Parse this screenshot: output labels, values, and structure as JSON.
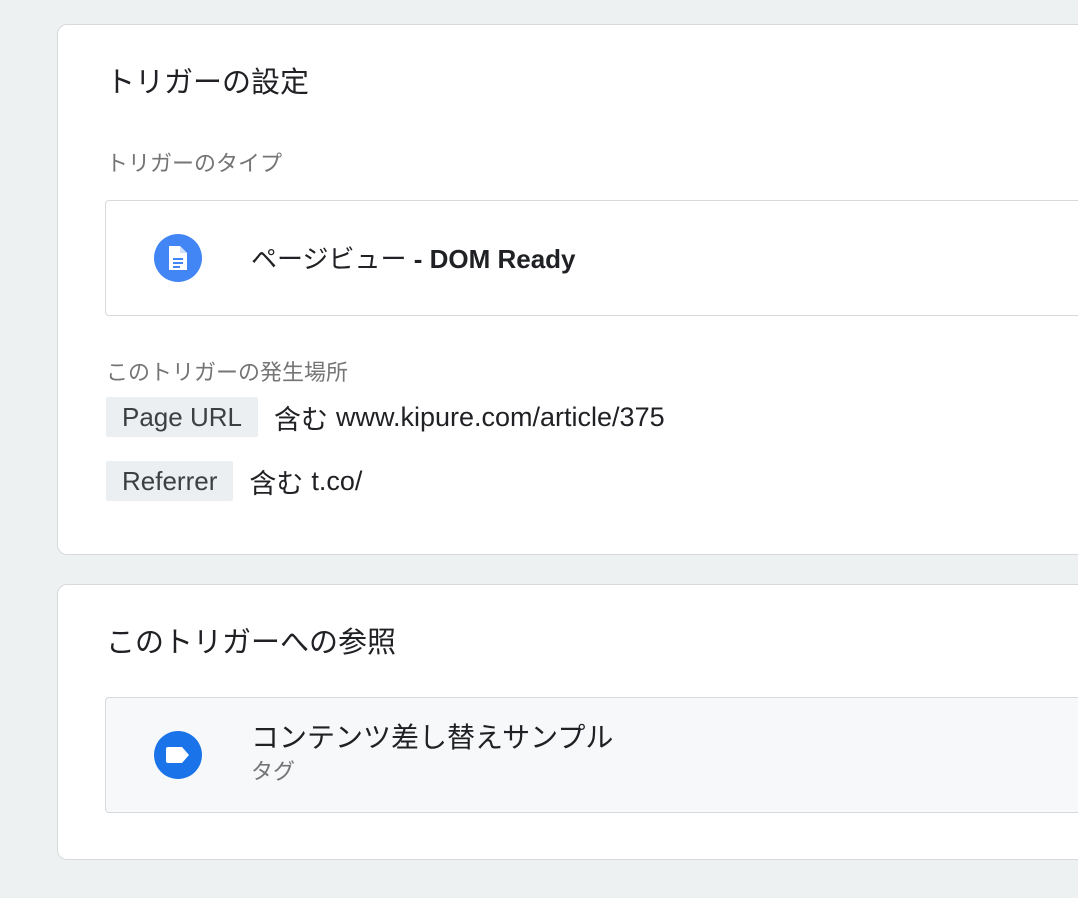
{
  "trigger_config": {
    "title": "トリガーの設定",
    "type_label": "トリガーのタイプ",
    "type": {
      "icon": "page-document-icon",
      "name_prefix": "ページビュー",
      "separator": " - ",
      "name_suffix": "DOM Ready"
    },
    "fires_on_label": "このトリガーの発生場所",
    "conditions": [
      {
        "variable": "Page URL",
        "operator": "含む",
        "value": "www.kipure.com/article/375"
      },
      {
        "variable": "Referrer",
        "operator": "含む",
        "value": "t.co/"
      }
    ]
  },
  "references": {
    "title": "このトリガーへの参照",
    "items": [
      {
        "name": "コンテンツ差し替えサンプル",
        "type": "タグ",
        "icon": "tag-icon"
      }
    ]
  },
  "colors": {
    "page_background": "#eef1f2",
    "trigger_type_icon": "#4285f4",
    "tag_icon": "#1a73e8",
    "chip_background": "#eceff1"
  }
}
